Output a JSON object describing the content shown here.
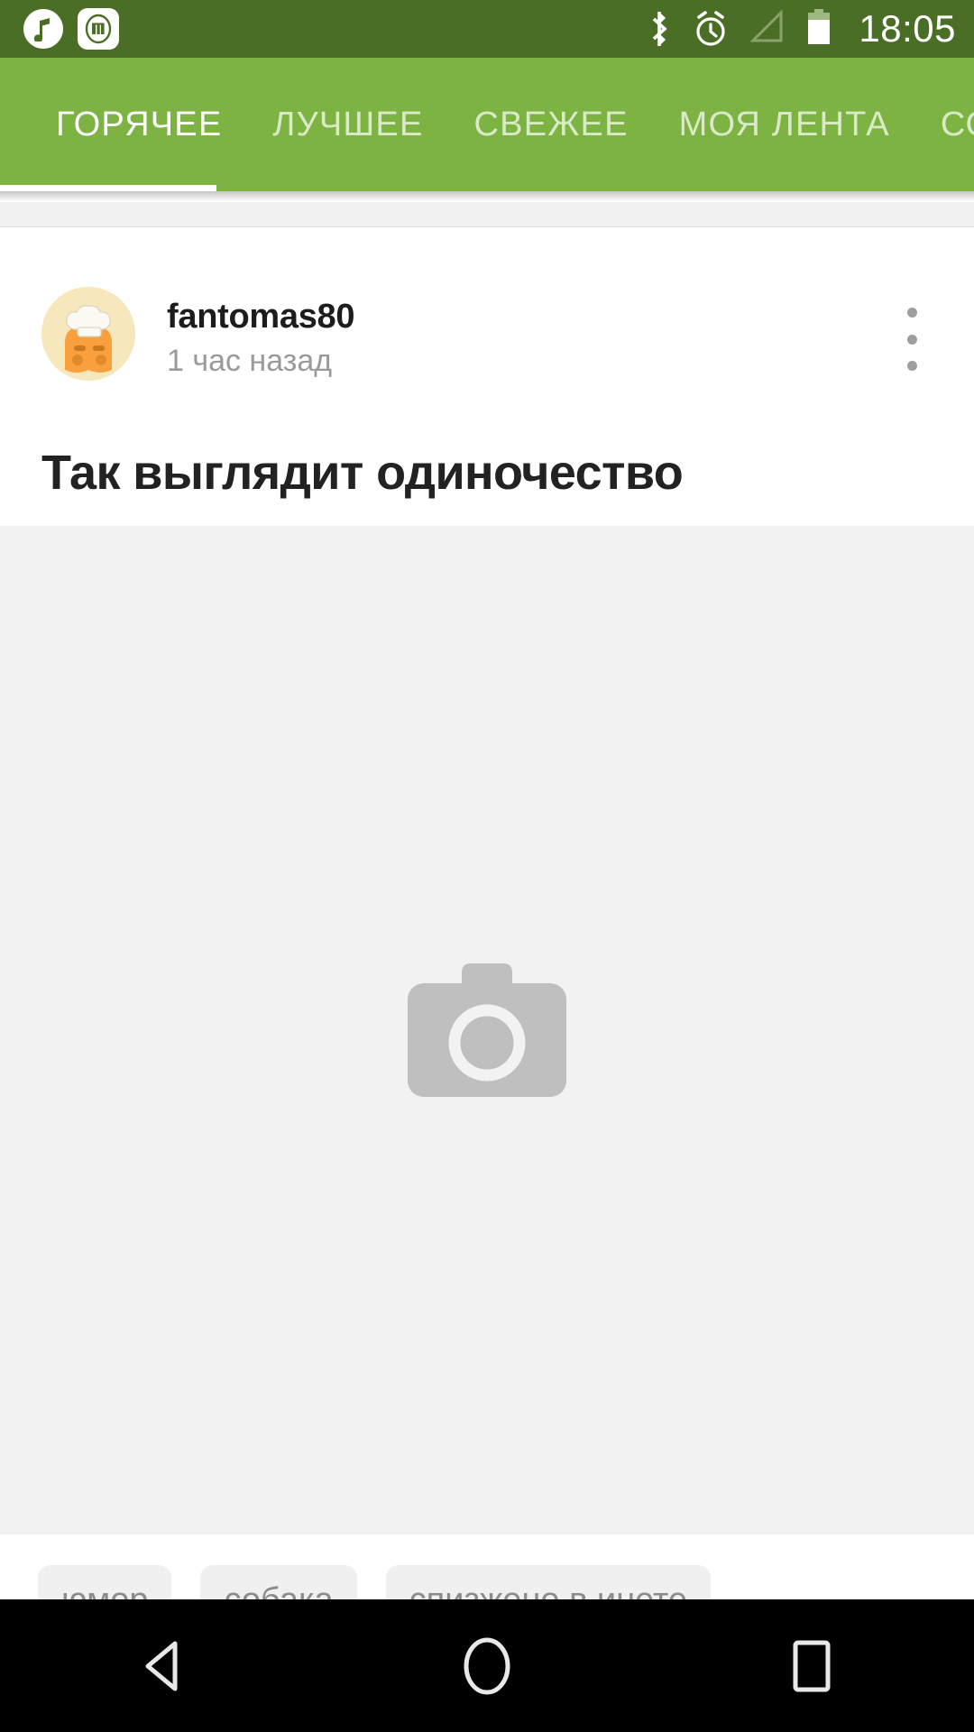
{
  "status_bar": {
    "time": "18:05",
    "background_color": "#4b6e27",
    "icons": [
      {
        "name": "music-notification-icon",
        "glyph": "♪"
      },
      {
        "name": "mi-app-notification-icon",
        "glyph": "mi"
      },
      {
        "name": "bluetooth-icon",
        "glyph": "bluetooth"
      },
      {
        "name": "alarm-clock-icon",
        "glyph": "alarm"
      },
      {
        "name": "signal-no-service-icon",
        "glyph": "signal"
      },
      {
        "name": "battery-icon",
        "glyph": "battery"
      }
    ]
  },
  "tab_bar": {
    "background_color": "#7cb342",
    "active_color": "#ffffff",
    "inactive_color": "#dbeac6",
    "active_index": 0,
    "tabs": [
      {
        "label": "ГОРЯЧЕЕ",
        "active": true
      },
      {
        "label": "ЛУЧШЕЕ",
        "active": false
      },
      {
        "label": "СВЕЖЕЕ",
        "active": false
      },
      {
        "label": "МОЯ ЛЕНТА",
        "active": false
      },
      {
        "label": "СООБЩЕСТВА",
        "active": false
      }
    ]
  },
  "post": {
    "author": "fantomas80",
    "timestamp": "1 час назад",
    "title": "Так выглядит одиночество",
    "image_placeholder_icon": "camera-icon",
    "image_background_color": "#f2f2f2",
    "overflow_menu_icon": "more-vertical-icon",
    "avatar": {
      "name": "avatar-toast-chef",
      "background_color": "#f7e7bd",
      "body_color": "#f9a03c",
      "hat_color": "#fbfaf2"
    },
    "tags": [
      "юмор",
      "собака",
      "спизжено в инете"
    ]
  },
  "nav_bar": {
    "background_color": "#000000",
    "buttons": [
      {
        "name": "nav-back-button",
        "icon": "triangle-left-icon"
      },
      {
        "name": "nav-home-button",
        "icon": "circle-icon"
      },
      {
        "name": "nav-recents-button",
        "icon": "square-icon"
      }
    ]
  }
}
